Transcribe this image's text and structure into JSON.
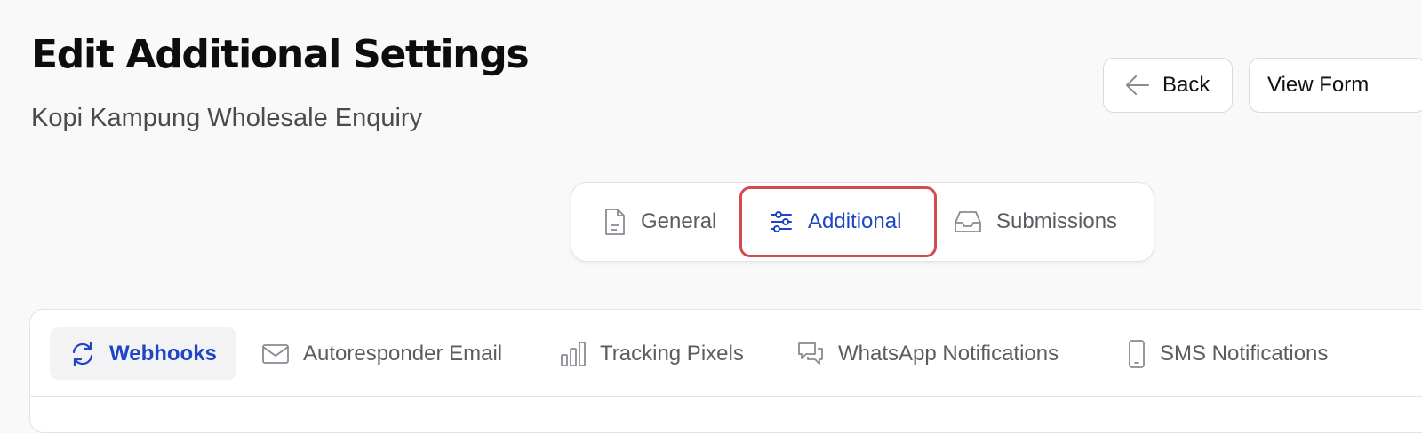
{
  "header": {
    "title": "Edit Additional Settings",
    "subtitle": "Kopi Kampung Wholesale Enquiry"
  },
  "actions": {
    "back_label": "Back",
    "view_form_label": "View Form"
  },
  "main_tabs": [
    {
      "label": "General",
      "icon": "document-icon",
      "active": false
    },
    {
      "label": "Additional",
      "icon": "sliders-icon",
      "active": true,
      "highlighted": true
    },
    {
      "label": "Submissions",
      "icon": "inbox-icon",
      "active": false
    }
  ],
  "settings_tabs": [
    {
      "label": "Webhooks",
      "icon": "refresh-icon",
      "active": true
    },
    {
      "label": "Autoresponder Email",
      "icon": "envelope-icon",
      "active": false
    },
    {
      "label": "Tracking Pixels",
      "icon": "bar-chart-icon",
      "active": false
    },
    {
      "label": "WhatsApp Notifications",
      "icon": "chat-bubbles-icon",
      "active": false
    },
    {
      "label": "SMS Notifications",
      "icon": "mobile-phone-icon",
      "active": false
    }
  ],
  "colors": {
    "accent": "#1f45c5",
    "highlight_border": "#d24b52",
    "inactive_text": "#5b5b63",
    "background": "#f9f9f9"
  }
}
